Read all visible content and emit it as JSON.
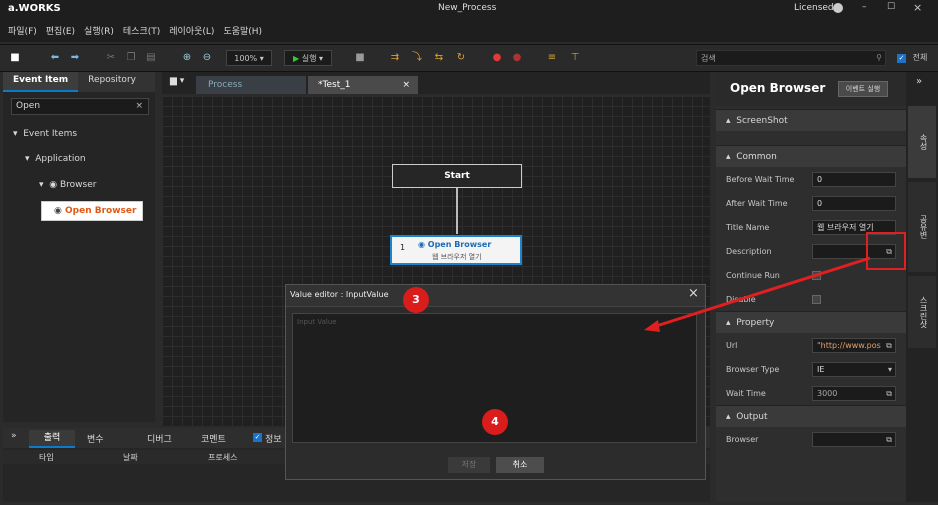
{
  "app": {
    "logo": "a.WORKS",
    "window_title": "New_Process",
    "license": "Licensed"
  },
  "menu": [
    "파일(F)",
    "편집(E)",
    "실행(R)",
    "테스크(T)",
    "레이아웃(L)",
    "도움말(H)"
  ],
  "toolbar": {
    "zoom": "100%",
    "run_label": "실행",
    "search_placeholder": "검색",
    "all_label": "전체"
  },
  "left_panel": {
    "tabs": [
      "Event Item",
      "Repository"
    ],
    "search_value": "Open",
    "tree": {
      "root": "Event Items",
      "group": "Application",
      "sub": "Browser",
      "item": "Open Browser"
    }
  },
  "doc_tabs": [
    "Process",
    "*Test_1"
  ],
  "flow": {
    "start": "Start",
    "node_num": "1",
    "node_title": "Open Browser",
    "node_subtitle": "웹 브라우저 열기"
  },
  "properties": {
    "title": "Open Browser",
    "event_button": "이벤트 실행",
    "sections": {
      "screenshot": "ScreenShot",
      "common": "Common",
      "property": "Property",
      "output": "Output"
    },
    "common": [
      {
        "label": "Before Wait Time",
        "value": "0"
      },
      {
        "label": "After Wait Time",
        "value": "0"
      },
      {
        "label": "Title Name",
        "value": "웹 브라우저 열기"
      },
      {
        "label": "Description",
        "value": ""
      },
      {
        "label": "Continue Run",
        "value": ""
      },
      {
        "label": "Disable",
        "value": ""
      }
    ],
    "property": [
      {
        "label": "Url",
        "value": "\"http://www.pos"
      },
      {
        "label": "Browser Type",
        "value": "IE"
      },
      {
        "label": "Wait Time",
        "value": "3000"
      }
    ],
    "output": [
      {
        "label": "Browser",
        "value": ""
      }
    ]
  },
  "side_tabs": [
    "속성",
    "공유변",
    "스크린샷"
  ],
  "bottom": {
    "tabs": [
      "출력",
      "변수",
      "디버그",
      "코멘트"
    ],
    "info_label": "정보",
    "columns": [
      "타입",
      "날짜",
      "프로세스"
    ]
  },
  "dialog": {
    "title": "Value editor : InputValue",
    "placeholder": "Input Value",
    "save": "저장",
    "cancel": "취소"
  },
  "annotations": {
    "badge3": "3",
    "badge4": "4"
  },
  "colors": {
    "accent": "#0a7ac9",
    "highlight_red": "#e02020",
    "selected_item": "#ffffff"
  }
}
